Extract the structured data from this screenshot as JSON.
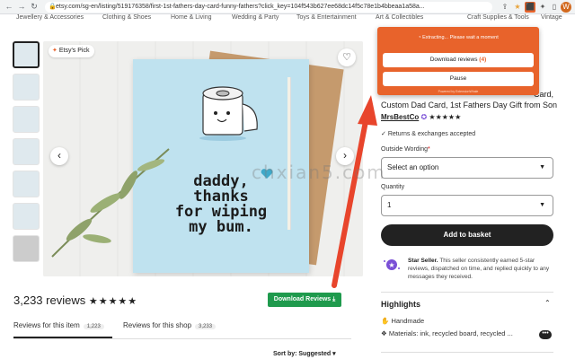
{
  "browser": {
    "url": "etsy.com/sg-en/listing/519176358/first-1st-fathers-day-card-funny-fathers?click_key=104f543b627ee68dc14f5c78e1b4bbeaa1a58a..."
  },
  "categories": [
    "Jewellery & Accessories",
    "Clothing & Shoes",
    "Home & Living",
    "Wedding & Party",
    "Toys & Entertainment",
    "Art & Collectibles",
    "Craft Supplies & Tools",
    "Vintage"
  ],
  "gallery": {
    "badge": "Etsy's Pick",
    "card_lines": [
      "daddy,",
      "thanks",
      "for wiping",
      "my bum."
    ]
  },
  "reviews": {
    "title": "3,233 reviews",
    "stars": "★★★★★",
    "download_label": "Download Reviews ⤓",
    "tab_item_label": "Reviews for this item",
    "tab_item_count": "1,223",
    "tab_shop_label": "Reviews for this shop",
    "tab_shop_count": "3,233",
    "sort_label": "Sort by: Suggested"
  },
  "listing": {
    "title_line1": "Card,",
    "title_line2": "Custom Dad Card, 1st Fathers Day Gift from Son",
    "shop_name": "MrsBestCo",
    "shop_stars": "★★★★★",
    "returns": "Returns & exchanges accepted",
    "outside_label": "Outside Wording",
    "outside_required": "*",
    "select_placeholder": "Select an option",
    "quantity_label": "Quantity",
    "quantity_value": "1",
    "basket_label": "Add to basket",
    "star_seller_title": "Star Seller.",
    "star_seller_text": "This seller consistently earned 5-star reviews, dispatched on time, and replied quickly to any messages they received.",
    "highlights_title": "Highlights",
    "highlight_1": "Handmade",
    "highlight_2": "Materials: ink, recycled board, recycled ..."
  },
  "popup": {
    "status": "Extracting... Please wait a moment",
    "download_label": "Download reviews",
    "download_count": "(4)",
    "pause_label": "Pause",
    "footer": "Powered by ExtensionWhale"
  },
  "watermark": "chxian5.com",
  "colors": {
    "popup": "#e8632b",
    "download_green": "#1f9a4d",
    "arrow": "#e8452c"
  }
}
